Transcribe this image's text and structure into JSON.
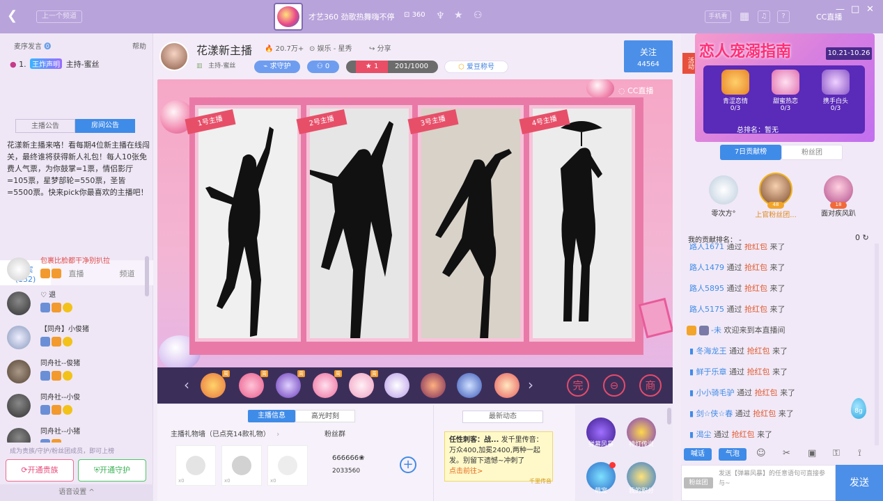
{
  "topbar": {
    "back_icon": "back-arrow-icon",
    "prev_channel": "上一个频道",
    "channel_title": "才艺360 劲歌热舞嗨不停",
    "channel_id": "360",
    "phone_watch": "手机看",
    "window_controls": [
      "—",
      "□",
      "✕"
    ]
  },
  "left": {
    "section_title": "麦序发言",
    "help": "帮助",
    "rank_item": {
      "num": "1.",
      "badge": "王炸声明",
      "text": "主持-蜜丝"
    },
    "ann_tabs": [
      "主播公告",
      "房间公告"
    ],
    "announcement": "花漾新主播来咯！看每期4位新主播在线闯关，最终谁将获得新人礼包！每人10张免费人气票，为你鼓掌=1票，情侣影厅=105票，星梦部轮=550票，圣皆=5500票。快来pick你最喜欢的主播吧！",
    "member_tabs": [
      {
        "label": "贵宾",
        "count": "(132)"
      },
      {
        "label": "直播"
      },
      {
        "label": "频道"
      }
    ],
    "users": [
      {
        "name": "包裹比脸都干净别扒拉",
        "red": true
      },
      {
        "name": "♡    退",
        "red": false
      },
      {
        "name": "【同舟】小俊猪",
        "red": false
      },
      {
        "name": "同舟社--俊猪",
        "red": false
      },
      {
        "name": "同舟社--小俊",
        "red": false
      },
      {
        "name": "同舟社--小猪",
        "red": false
      }
    ],
    "guard_note": "成为贵族/守护/粉丝团成员，即可上榜",
    "btn_noble": "开通贵族",
    "btn_guard": "开通守护",
    "voice_settings": "语音设置 ^"
  },
  "anchor": {
    "name": "花漾新主播",
    "popularity": "20.7万+",
    "category": "娱乐 - 星秀",
    "share": "分享",
    "subtitle": "主持-蜜丝",
    "guard_btn": "求守护",
    "fans": "0",
    "level": "1",
    "level_progress": "201/1000",
    "nick_btn": "爱豆称号",
    "follow": "关注",
    "follower_count": "44564"
  },
  "stage": {
    "watermark": "CC直播",
    "panels": [
      "1号主播",
      "2号主播",
      "3号主播",
      "4号主播"
    ]
  },
  "lower": {
    "tabs": [
      "主播信息",
      "高光时刻"
    ],
    "gift_wall": "主播礼物墙（已点亮14款礼物）",
    "fans_group": "粉丝群",
    "wall_counts": [
      "x0",
      "x0",
      "x0"
    ],
    "fans_num": "666666❀",
    "fans_id": "2033560",
    "news_btn": "最新动态",
    "news_title": "任性刺客：战...",
    "news_body": "发千里传音：万众400,加冕2400,两种一起发。别留下遗憾~冲刺了",
    "news_link": "点击前往>",
    "news_foot": "千里传音",
    "funcs": [
      "弹幕风暴",
      "神灯传说",
      "萌宠",
      "我的积分"
    ]
  },
  "right": {
    "banner_title": "恋人宠溺指南",
    "banner_date": "10.21-10.26",
    "banner_items": [
      {
        "label": "青涩恋情",
        "count": "0/3"
      },
      {
        "label": "甜蜜热恋",
        "count": "0/3"
      },
      {
        "label": "携手白头",
        "count": "0/3"
      }
    ],
    "banner_total": "总排名：暂无",
    "side_tag": "活动",
    "rank_tabs": [
      "7日贡献榜",
      "粉丝团"
    ],
    "podium": [
      "零次方°",
      "上官粉丝团...",
      "面对疾风趴"
    ],
    "podium_lv": [
      "",
      "48",
      "18"
    ],
    "my_rank_label": "我的贡献排名： -",
    "my_rank_value": "0",
    "chat": [
      {
        "user": "路人1671",
        "mid": "通过",
        "red": "抢红包",
        "end": "来了"
      },
      {
        "user": "路人1479",
        "mid": "通过",
        "red": "抢红包",
        "end": "来了"
      },
      {
        "user": "路人5895",
        "mid": "通过",
        "red": "抢红包",
        "end": "来了"
      },
      {
        "user": "路人5175",
        "mid": "通过",
        "red": "抢红包",
        "end": "来了"
      },
      {
        "user": "-未",
        "mid": "欢迎来到本直播间",
        "red": "",
        "end": ""
      },
      {
        "user": "冬海龙王",
        "mid": "通过",
        "red": "抢红包",
        "end": "来了"
      },
      {
        "user": "鲜于乐章",
        "mid": "通过",
        "red": "抢红包",
        "end": "来了"
      },
      {
        "user": "小小骑毛驴",
        "mid": "通过",
        "red": "抢红包",
        "end": "来了"
      },
      {
        "user": "剑☆侠☆春",
        "mid": "通过",
        "red": "抢红包",
        "end": "来了"
      },
      {
        "user": "渴尘",
        "mid": "通过",
        "red": "抢红包",
        "end": "来了"
      }
    ],
    "drop_label": "8g",
    "tool_btns": [
      "喊话",
      "气泡"
    ],
    "fan_badge": "粉丝团",
    "input_placeholder": "发送【弹幕风暴】的任意语句可直接参与~",
    "send": "发送"
  }
}
